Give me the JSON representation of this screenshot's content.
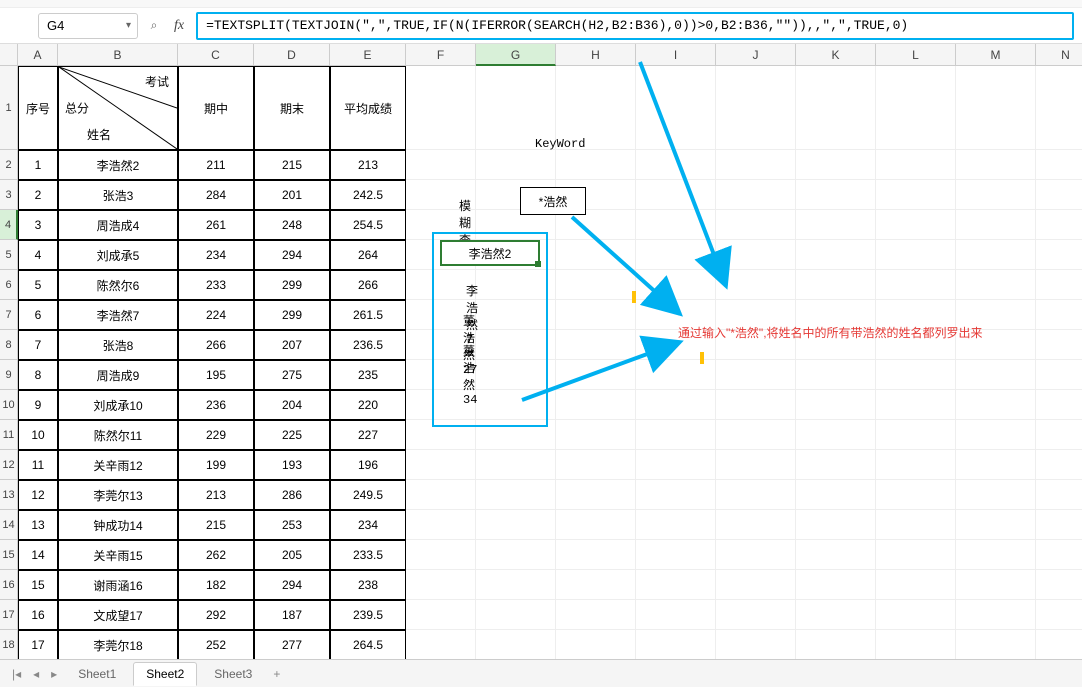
{
  "namebox": "G4",
  "formula": "=TEXTSPLIT(TEXTJOIN(\",\",TRUE,IF(N(IFERROR(SEARCH(H2,B2:B36),0))>0,B2:B36,\"\")),,\",\",TRUE,0)",
  "columns": [
    "A",
    "B",
    "C",
    "D",
    "E",
    "F",
    "G",
    "H",
    "I",
    "J",
    "K",
    "L",
    "M",
    "N"
  ],
  "header": {
    "seq": "序号",
    "diag_top": "考试",
    "diag_mid": "总分",
    "diag_bot": "姓名",
    "mid": "期中",
    "end": "期末",
    "avg": "平均成绩"
  },
  "rows": [
    {
      "r": "1",
      "n": "李浩然2",
      "m": "211",
      "e": "215",
      "a": "213"
    },
    {
      "r": "2",
      "n": "张浩3",
      "m": "284",
      "e": "201",
      "a": "242.5"
    },
    {
      "r": "3",
      "n": "周浩成4",
      "m": "261",
      "e": "248",
      "a": "254.5"
    },
    {
      "r": "4",
      "n": "刘成承5",
      "m": "234",
      "e": "294",
      "a": "264"
    },
    {
      "r": "5",
      "n": "陈然尔6",
      "m": "233",
      "e": "299",
      "a": "266"
    },
    {
      "r": "6",
      "n": "李浩然7",
      "m": "224",
      "e": "299",
      "a": "261.5"
    },
    {
      "r": "7",
      "n": "张浩8",
      "m": "266",
      "e": "207",
      "a": "236.5"
    },
    {
      "r": "8",
      "n": "周浩成9",
      "m": "195",
      "e": "275",
      "a": "235"
    },
    {
      "r": "9",
      "n": "刘成承10",
      "m": "236",
      "e": "204",
      "a": "220"
    },
    {
      "r": "10",
      "n": "陈然尔11",
      "m": "229",
      "e": "225",
      "a": "227"
    },
    {
      "r": "11",
      "n": "关辛雨12",
      "m": "199",
      "e": "193",
      "a": "196"
    },
    {
      "r": "12",
      "n": "李莞尔13",
      "m": "213",
      "e": "286",
      "a": "249.5"
    },
    {
      "r": "13",
      "n": "钟成功14",
      "m": "215",
      "e": "253",
      "a": "234"
    },
    {
      "r": "14",
      "n": "关辛雨15",
      "m": "262",
      "e": "205",
      "a": "233.5"
    },
    {
      "r": "15",
      "n": "谢雨涵16",
      "m": "182",
      "e": "294",
      "a": "238"
    },
    {
      "r": "16",
      "n": "文成望17",
      "m": "292",
      "e": "187",
      "a": "239.5"
    },
    {
      "r": "17",
      "n": "李莞尔18",
      "m": "252",
      "e": "277",
      "a": "264.5"
    }
  ],
  "keyword_label": "KeyWord",
  "fuzzy_label": "模糊查找",
  "keyword_value": "*浩然",
  "results": [
    "李浩然2",
    "李浩然7",
    "董浩然27",
    "董浩然34"
  ],
  "annotation": "通过输入\"*浩然\",将姓名中的所有带浩然的姓名都列罗出来",
  "sheets": [
    "Sheet1",
    "Sheet2",
    "Sheet3"
  ],
  "active_sheet": 1
}
